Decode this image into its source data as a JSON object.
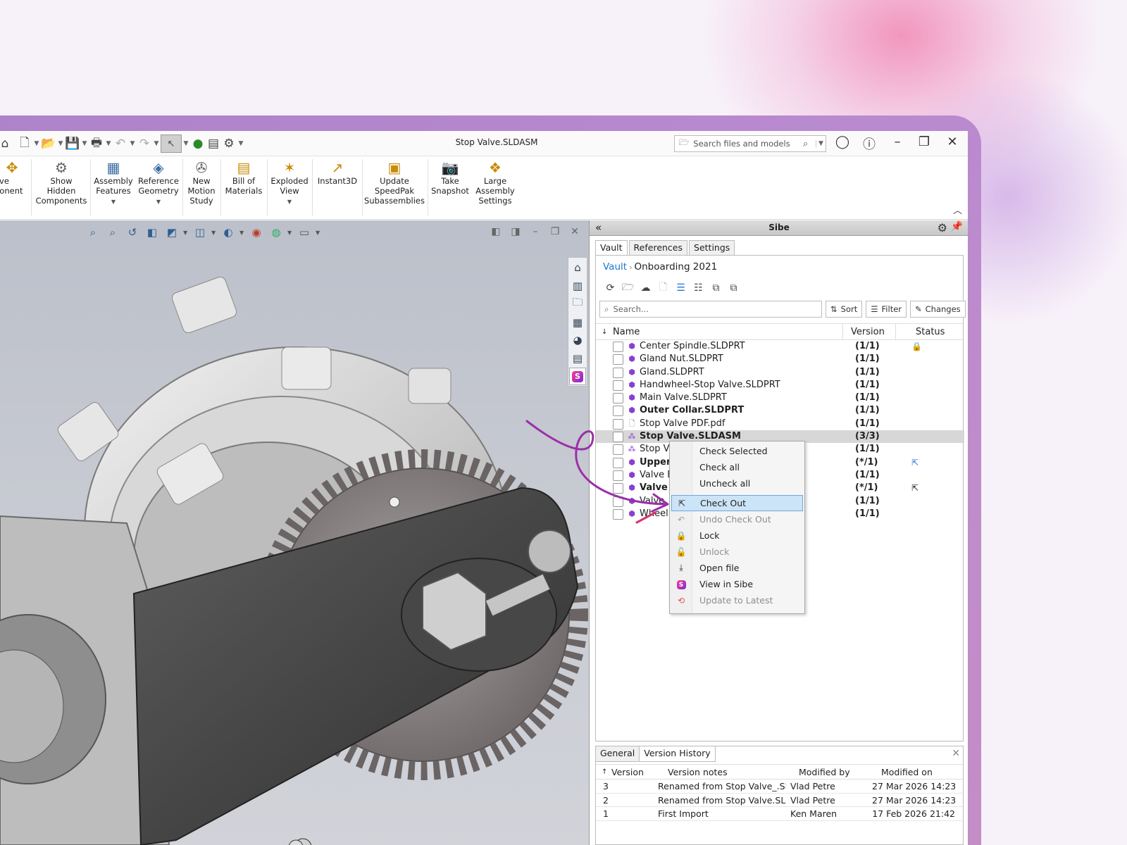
{
  "titlebar": {
    "document_title": "Stop Valve.SLDASM",
    "search_placeholder": "Search files and models"
  },
  "ribbon": {
    "items": [
      {
        "label": "ove\nponent",
        "icon": "move-component-icon"
      },
      {
        "label": "Show\nHidden\nComponents",
        "icon": "show-hidden-icon"
      },
      {
        "label": "Assembly\nFeatures",
        "icon": "assembly-features-icon"
      },
      {
        "label": "Reference\nGeometry",
        "icon": "reference-geometry-icon"
      },
      {
        "label": "New\nMotion\nStudy",
        "icon": "motion-study-icon"
      },
      {
        "label": "Bill of\nMaterials",
        "icon": "bill-of-materials-icon"
      },
      {
        "label": "Exploded\nView",
        "icon": "exploded-view-icon"
      },
      {
        "label": "Instant3D",
        "icon": "instant3d-icon"
      },
      {
        "label": "Update\nSpeedPak\nSubassemblies",
        "icon": "speedpak-icon"
      },
      {
        "label": "Take\nSnapshot",
        "icon": "camera-icon"
      },
      {
        "label": "Large\nAssembly\nSettings",
        "icon": "large-assembly-icon"
      }
    ]
  },
  "panel": {
    "title": "Sibe",
    "tabs": [
      "Vault",
      "References",
      "Settings"
    ],
    "breadcrumb": {
      "root": "Vault",
      "current": "Onboarding 2021"
    },
    "search_placeholder": "Search...",
    "buttons": {
      "sort": "Sort",
      "filter": "Filter",
      "changes": "Changes"
    },
    "columns": {
      "name": "Name",
      "version": "Version",
      "status": "Status"
    },
    "files": [
      {
        "name": "Center Spindle.SLDPRT",
        "version": "(1/1)",
        "bold": false,
        "status": "lock-icon"
      },
      {
        "name": "Gland Nut.SLDPRT",
        "version": "(1/1)",
        "bold": false,
        "status": ""
      },
      {
        "name": "Gland.SLDPRT",
        "version": "(1/1)",
        "bold": false,
        "status": ""
      },
      {
        "name": "Handwheel-Stop Valve.SLDPRT",
        "version": "(1/1)",
        "bold": false,
        "status": ""
      },
      {
        "name": "Main Valve.SLDPRT",
        "version": "(1/1)",
        "bold": false,
        "status": ""
      },
      {
        "name": "Outer Collar.SLDPRT",
        "version": "(1/1)",
        "bold": true,
        "status": ""
      },
      {
        "name": "Stop Valve PDF.pdf",
        "version": "(1/1)",
        "bold": false,
        "status": ""
      },
      {
        "name": "Stop Valve.SLDASM",
        "version": "(3/3)",
        "bold": true,
        "status": ""
      },
      {
        "name": "Stop V",
        "version": "(1/1)",
        "bold": false,
        "status": ""
      },
      {
        "name": "Upper",
        "version": "(*/1)",
        "bold": true,
        "status": "checkout-icon"
      },
      {
        "name": "Valve E",
        "version": "(1/1)",
        "bold": false,
        "status": ""
      },
      {
        "name": "Valve I",
        "version": "(*/1)",
        "bold": true,
        "status": "checkout-icon-dark"
      },
      {
        "name": "Valve",
        "version": "(1/1)",
        "bold": false,
        "status": ""
      },
      {
        "name": "Wheel",
        "version": "(1/1)",
        "bold": false,
        "status": ""
      }
    ],
    "bottom": {
      "tabs": [
        "General",
        "Version History"
      ],
      "columns": [
        "Version",
        "Version notes",
        "Modified by",
        "Modified on"
      ],
      "rows": [
        [
          "3",
          "Renamed from Stop Valve_.SL",
          "Vlad Petre",
          "27 Mar 2026 14:23"
        ],
        [
          "2",
          "Renamed from Stop Valve.SLI",
          "Vlad Petre",
          "27 Mar 2026 14:23"
        ],
        [
          "1",
          "First Import",
          "Ken Maren",
          "17 Feb 2026 21:42"
        ]
      ]
    }
  },
  "context_menu": {
    "items": [
      {
        "label": "Check Selected",
        "icon": "",
        "disabled": false
      },
      {
        "label": "Check all",
        "icon": "",
        "disabled": false
      },
      {
        "label": "Uncheck all",
        "icon": "",
        "disabled": false
      },
      {
        "label": "Check Out",
        "icon": "checkout-icon",
        "disabled": false,
        "highlighted": true
      },
      {
        "label": "Undo Check Out",
        "icon": "undo-icon",
        "disabled": true
      },
      {
        "label": "Lock",
        "icon": "lock-icon",
        "disabled": false
      },
      {
        "label": "Unlock",
        "icon": "unlock-icon",
        "disabled": true
      },
      {
        "label": "Open file",
        "icon": "download-icon",
        "disabled": false
      },
      {
        "label": "View in Sibe",
        "icon": "sibe-logo-icon",
        "disabled": false
      },
      {
        "label": "Update to Latest",
        "icon": "update-icon",
        "disabled": true
      }
    ]
  },
  "colors": {
    "accent": "#1f78d1",
    "frame": "#b587cf",
    "annotation": "#9b2fa8"
  }
}
